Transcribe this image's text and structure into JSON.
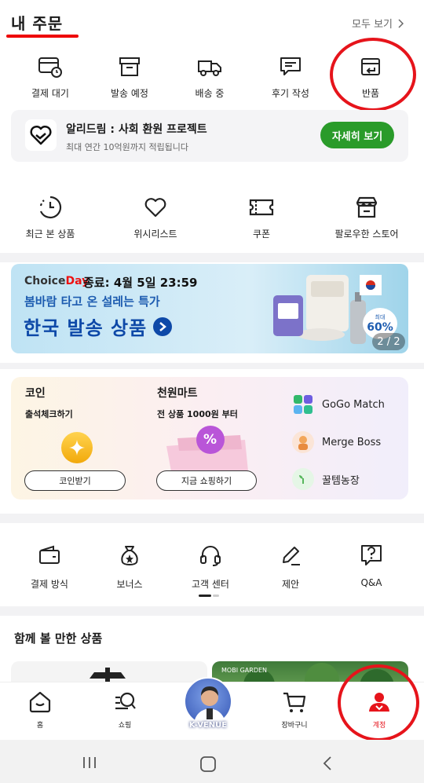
{
  "header": {
    "title": "내 주문",
    "see_all": "모두 보기"
  },
  "orders": [
    {
      "label": "결제 대기",
      "icon": "wallet-clock-icon"
    },
    {
      "label": "발송 예정",
      "icon": "box-icon"
    },
    {
      "label": "배송 중",
      "icon": "truck-icon"
    },
    {
      "label": "후기 작성",
      "icon": "review-icon"
    },
    {
      "label": "반품",
      "icon": "return-icon"
    }
  ],
  "promo": {
    "title": "알리드림 : 사회 환원 프로젝트",
    "subtitle": "최대 연간 10억원까지 적립됩니다",
    "button": "자세히 보기"
  },
  "quick": [
    {
      "label": "최근 본 상품",
      "icon": "history-icon"
    },
    {
      "label": "위시리스트",
      "icon": "heart-icon"
    },
    {
      "label": "쿠폰",
      "icon": "coupon-icon"
    },
    {
      "label": "팔로우한 스토어",
      "icon": "store-icon"
    }
  ],
  "banner": {
    "brand_a": "Choice",
    "brand_b": "Day",
    "deadline": "종료: 4월 5일 23:59",
    "subtitle": "봄바람 타고 온 설레는 특가",
    "headline": "한국 발송 상품",
    "discount_small": "최대",
    "discount": "60%",
    "page": "2 / 2"
  },
  "coins": {
    "title": "코인",
    "subtitle": "출석체크하기",
    "button": "코인받기"
  },
  "mart": {
    "title": "천원마트",
    "subtitle": "전 상품 1000원 부터",
    "button": "지금 쇼핑하기",
    "badge": "%"
  },
  "games": [
    {
      "label": "GoGo Match"
    },
    {
      "label": "Merge Boss"
    },
    {
      "label": "꿀템농장"
    }
  ],
  "tools": [
    {
      "label": "결제 방식",
      "icon": "wallet-icon"
    },
    {
      "label": "보너스",
      "icon": "bonus-bag-icon"
    },
    {
      "label": "고객 센터",
      "icon": "headset-icon"
    },
    {
      "label": "제안",
      "icon": "pencil-icon"
    },
    {
      "label": "Q&A",
      "icon": "question-icon"
    }
  ],
  "recommend": {
    "title": "함께 볼 만한 상품",
    "brand": "MOBI GARDEN"
  },
  "nav": [
    {
      "label": "홈",
      "icon": "home-icon"
    },
    {
      "label": "쇼핑",
      "icon": "shopping-search-icon"
    },
    {
      "label": "K-VENUE",
      "icon": "k-venue-avatar"
    },
    {
      "label": "장바구니",
      "icon": "cart-icon"
    },
    {
      "label": "계정",
      "icon": "account-icon"
    }
  ],
  "colors": {
    "accent_red": "#e6141b",
    "promo_green": "#2a9b2a",
    "banner_blue": "#0e49a8"
  }
}
